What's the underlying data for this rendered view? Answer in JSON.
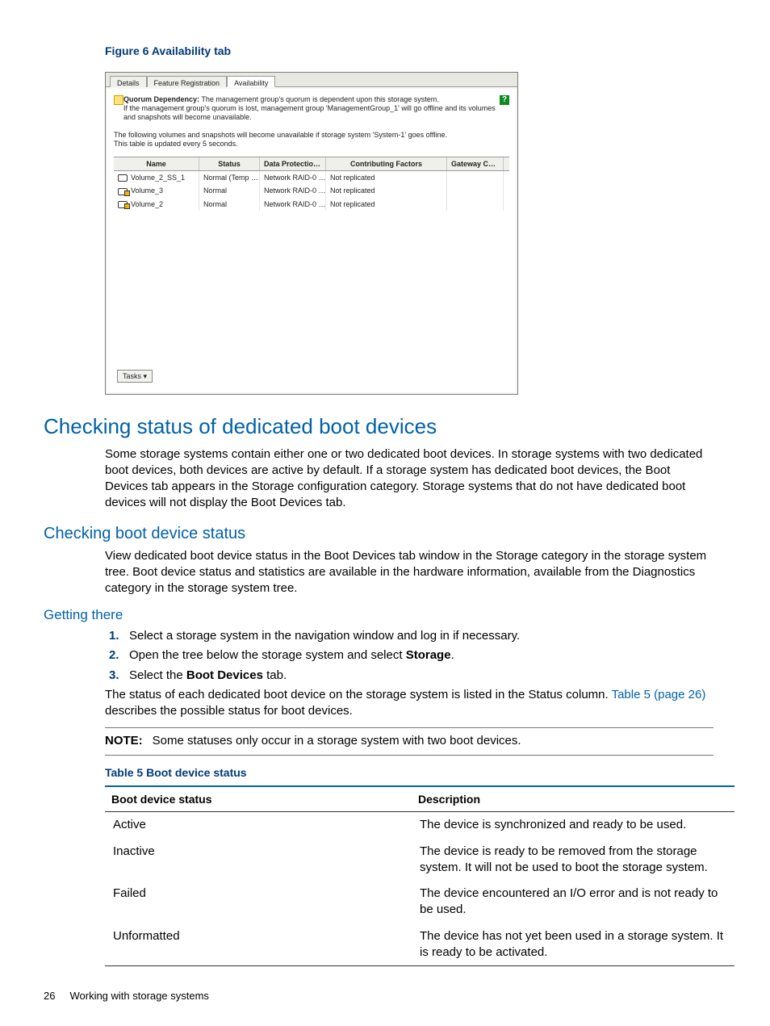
{
  "figure": {
    "caption": "Figure 6 Availability tab"
  },
  "screenshot": {
    "tabs": {
      "details": "Details",
      "feature": "Feature Registration",
      "availability": "Availability"
    },
    "warning_label": "Quorum Dependency:",
    "warning_text": " The management group's quorum is dependent upon this storage system.",
    "warning_line2": "If the management group's quorum is lost, management group 'ManagementGroup_1' will go offline and its volumes and snapshots will become unavailable.",
    "info_line1": "The following volumes and snapshots will become unavailable if storage system 'System-1' goes offline.",
    "info_line2": "This table is updated every 5 seconds.",
    "help_glyph": "?",
    "columns": {
      "name": "Name",
      "status": "Status",
      "data": "Data Protectio…",
      "contrib": "Contributing Factors",
      "gw": "Gateway C…"
    },
    "rows": [
      {
        "name": "Volume_2_SS_1",
        "status": "Normal (Temp …",
        "data": "Network RAID-0 …",
        "contrib": "Not replicated",
        "gw": "",
        "locked": false
      },
      {
        "name": "Volume_3",
        "status": "Normal",
        "data": "Network RAID-0 …",
        "contrib": "Not replicated",
        "gw": "",
        "locked": true
      },
      {
        "name": "Volume_2",
        "status": "Normal",
        "data": "Network RAID-0 …",
        "contrib": "Not replicated",
        "gw": "",
        "locked": true
      }
    ],
    "tasks_label": "Tasks ▾"
  },
  "headings": {
    "h1": "Checking status of dedicated boot devices",
    "h2": "Checking boot device status",
    "h3": "Getting there"
  },
  "paragraphs": {
    "p1": "Some storage systems contain either one or two dedicated boot devices. In storage systems with two dedicated boot devices, both devices are active by default. If a storage system has dedicated boot devices, the Boot Devices tab appears in the Storage configuration category. Storage systems that do not have dedicated boot devices will not display the Boot Devices tab.",
    "p2": "View dedicated boot device status in the Boot Devices tab window in the Storage category in the storage system tree. Boot device status and statistics are available in the hardware information, available from the Diagnostics category in the storage system tree.",
    "status_intro": "The status of each dedicated boot device on the storage system is listed in the Status column. ",
    "status_link": "Table 5 (page 26)",
    "status_after": " describes the possible status for boot devices."
  },
  "steps": {
    "s1": "Select a storage system in the navigation window and log in if necessary.",
    "s2_a": "Open the tree below the storage system and select ",
    "s2_b": "Storage",
    "s2_c": ".",
    "s3_a": "Select the ",
    "s3_b": "Boot Devices",
    "s3_c": " tab."
  },
  "note": {
    "label": "NOTE:",
    "text": "Some statuses only occur in a storage system with two boot devices."
  },
  "table5": {
    "caption": "Table 5 Boot device status",
    "head": {
      "c1": "Boot device status",
      "c2": "Description"
    },
    "rows": [
      {
        "c1": "Active",
        "c2": "The device is synchronized and ready to be used."
      },
      {
        "c1": "Inactive",
        "c2": "The device is ready to be removed from the storage system. It will not be used to boot the storage system."
      },
      {
        "c1": "Failed",
        "c2": "The device encountered an I/O error and is not ready to be used."
      },
      {
        "c1": "Unformatted",
        "c2": "The device has not yet been used in a storage system. It is ready to be activated."
      }
    ]
  },
  "footer": {
    "page": "26",
    "section": "Working with storage systems"
  }
}
